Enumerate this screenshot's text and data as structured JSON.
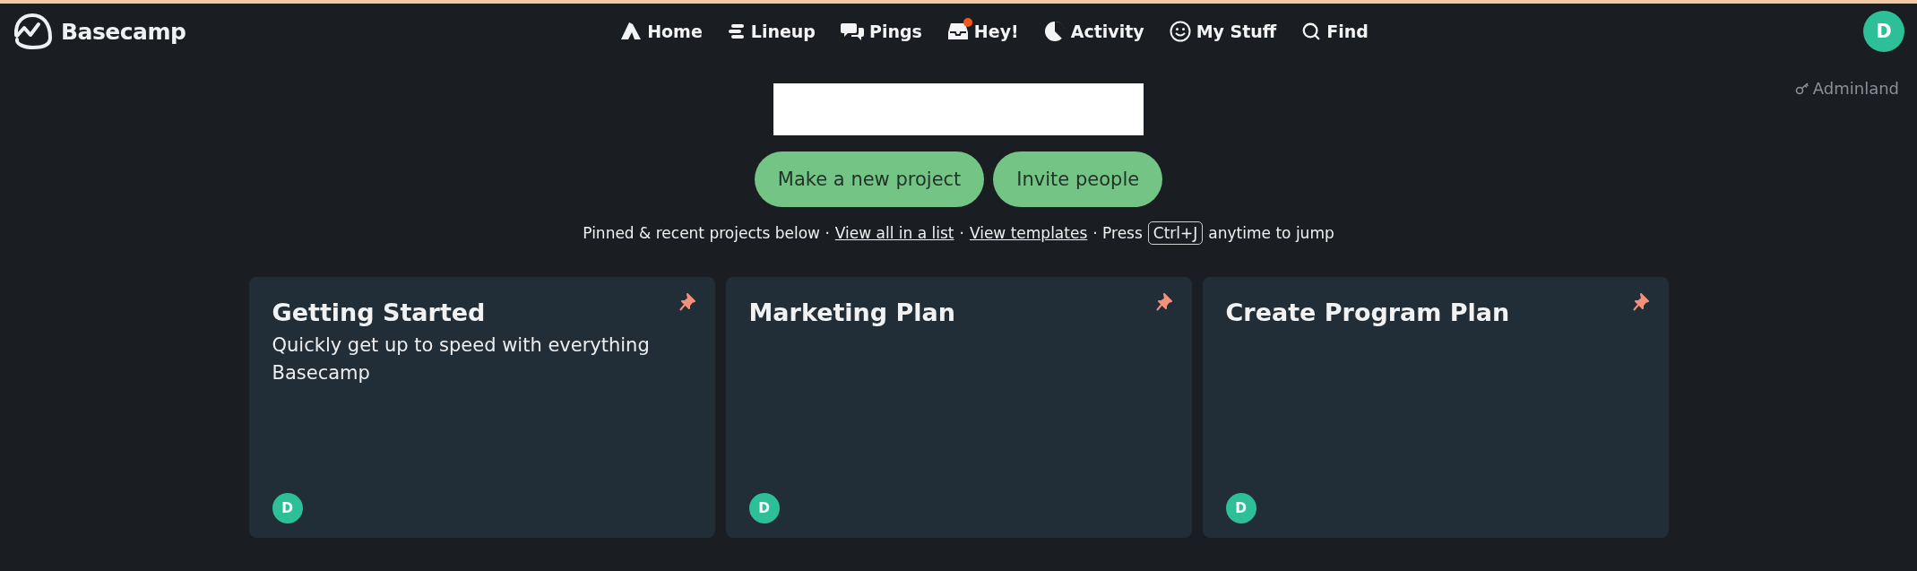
{
  "brand": {
    "name": "Basecamp"
  },
  "nav": [
    {
      "kind": "home",
      "label": "Home",
      "unread": false
    },
    {
      "kind": "lineup",
      "label": "Lineup",
      "unread": false
    },
    {
      "kind": "pings",
      "label": "Pings",
      "unread": false
    },
    {
      "kind": "hey",
      "label": "Hey!",
      "unread": true
    },
    {
      "kind": "activity",
      "label": "Activity",
      "unread": false
    },
    {
      "kind": "mystuff",
      "label": "My Stuff",
      "unread": false
    },
    {
      "kind": "find",
      "label": "Find",
      "unread": false
    }
  ],
  "user": {
    "initial": "D"
  },
  "adminland": {
    "label": "Adminland"
  },
  "actions": [
    "Make a new project",
    "Invite people"
  ],
  "hint": {
    "text1": "Pinned & recent projects below ·",
    "link1": "View all in a list",
    "text2": "·",
    "link2": "View templates",
    "text3": "· Press",
    "key": "Ctrl+J",
    "text4": "anytime to jump"
  },
  "projects": [
    {
      "title": "Getting Started",
      "description": "Quickly get up to speed with everything Basecamp",
      "pinned": true,
      "member": "D"
    },
    {
      "title": "Marketing Plan",
      "pinned": true,
      "member": "D"
    },
    {
      "title": "Create Program Plan",
      "pinned": true,
      "member": "D"
    }
  ]
}
